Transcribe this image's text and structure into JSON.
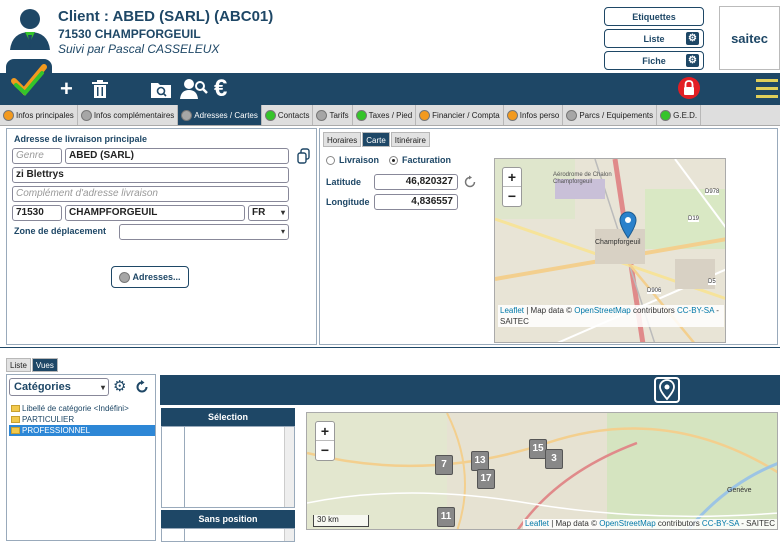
{
  "header": {
    "client_title": "Client : ABED (SARL) (ABC01)",
    "client_city": "71530 CHAMPFORGEUIL",
    "follow_up": "Suivi par Pascal CASSELEUX",
    "btn_labels": "Etiquettes",
    "btn_list": "Liste",
    "btn_sheet": "Fiche",
    "logo_text": "saitec"
  },
  "toolbar": {
    "icons": [
      "check-icon",
      "plus-icon",
      "trash-icon",
      "folder-search-icon",
      "user-search-icon",
      "euro-icon",
      "lock-icon",
      "menu-icon"
    ],
    "euro_glyph": "€",
    "plus_glyph": "+"
  },
  "tabs": [
    {
      "label": "Infos principales",
      "status": "orange"
    },
    {
      "label": "Infos complémentaires",
      "status": "gray"
    },
    {
      "label": "Adresses / Cartes",
      "status": "gray",
      "active": true
    },
    {
      "label": "Contacts",
      "status": "green"
    },
    {
      "label": "Tarifs",
      "status": "gray"
    },
    {
      "label": "Taxes / Pied",
      "status": "green"
    },
    {
      "label": "Financier / Compta",
      "status": "orange"
    },
    {
      "label": "Infos perso",
      "status": "orange"
    },
    {
      "label": "Parcs / Equipements",
      "status": "gray"
    },
    {
      "label": "G.E.D.",
      "status": "green"
    }
  ],
  "address": {
    "section_label": "Adresse de livraison principale",
    "genre_placeholder": "Genre",
    "name": "ABED (SARL)",
    "street": "zi Blettrys",
    "complement_placeholder": "Complément d'adresse livraison",
    "postal_code": "71530",
    "city": "CHAMPFORGEUIL",
    "country": "FR",
    "zone_label": "Zone de déplacement",
    "zone_value": "",
    "addresses_button": "Adresses..."
  },
  "map_panel": {
    "subtabs": [
      {
        "label": "Horaires"
      },
      {
        "label": "Carte",
        "active": true
      },
      {
        "label": "Itinéraire"
      }
    ],
    "radio_delivery": "Livraison",
    "radio_billing": "Facturation",
    "radio_selected": "Facturation",
    "latitude_label": "Latitude",
    "latitude_value": "46,820327",
    "longitude_label": "Longitude",
    "longitude_value": "4,836557",
    "map_labels": {
      "place": "Champforgeuil",
      "airport": "Aérodrome de Chalon Champforgeuil",
      "road1": "D19",
      "road2": "D906",
      "road3": "D5",
      "road4": "D978"
    },
    "attribution_leaflet": "Leaflet",
    "attribution_mid": " | Map data © ",
    "attribution_osm": "OpenStreetMap",
    "attribution_contrib": " contributors ",
    "attribution_license": "CC-BY-SA",
    "attribution_end": " - SAITEC",
    "zoom_in": "+",
    "zoom_out": "−"
  },
  "bottom": {
    "tabs": [
      {
        "label": "Liste"
      },
      {
        "label": "Vues",
        "active": true
      }
    ],
    "category_select": "Catégories",
    "categories": [
      {
        "label": "Libellé de catégorie <Indéfini>"
      },
      {
        "label": "PARTICULIER"
      },
      {
        "label": "PROFESSIONNEL",
        "selected": true
      }
    ],
    "selection_header": "Sélection",
    "no_position_header": "Sans position",
    "scale": "30 km",
    "clusters": [
      "7",
      "13",
      "17",
      "15",
      "3",
      "11"
    ],
    "town": "Genève",
    "attribution_leaflet": "Leaflet",
    "attribution_mid": " | Map data © ",
    "attribution_osm": "OpenStreetMap",
    "attribution_contrib": " contributors ",
    "attribution_license": "CC-BY-SA",
    "attribution_end": " - SAITEC"
  },
  "colors": {
    "primary": "#1e4766",
    "accent_green": "#35c42a",
    "accent_orange": "#f39a1e",
    "lock_red": "#e31e24",
    "selection_blue": "#2d87d6"
  }
}
